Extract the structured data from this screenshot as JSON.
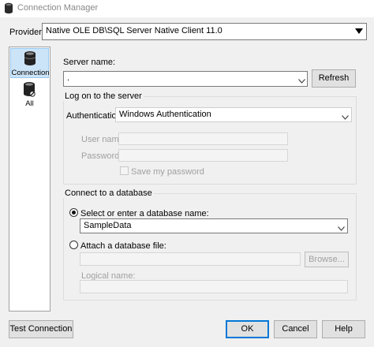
{
  "window": {
    "title": "Connection Manager",
    "icon": "database-icon"
  },
  "provider": {
    "label": "Provider:",
    "value": "Native OLE DB\\SQL Server Native Client 11.0"
  },
  "nav": {
    "items": [
      {
        "label": "Connection",
        "icon": "database-icon",
        "selected": true
      },
      {
        "label": "All",
        "icon": "database-tools-icon",
        "selected": false
      }
    ]
  },
  "server": {
    "label": "Server name:",
    "value": ".",
    "refresh_label": "Refresh"
  },
  "logon": {
    "title": "Log on to the server",
    "auth_label": "Authentication:",
    "auth_value": "Windows Authentication",
    "username_label": "User name:",
    "password_label": "Password:",
    "save_password_label": "Save my password"
  },
  "database": {
    "title": "Connect to a database",
    "select_label": "Select or enter a database name:",
    "select_value": "SampleData",
    "attach_label": "Attach a database file:",
    "browse_label": "Browse...",
    "logical_name_label": "Logical name:"
  },
  "footer": {
    "test_label": "Test Connection",
    "ok_label": "OK",
    "cancel_label": "Cancel",
    "help_label": "Help"
  },
  "colors": {
    "selection": "#cce4f7",
    "default_button_border": "#0078d7"
  }
}
